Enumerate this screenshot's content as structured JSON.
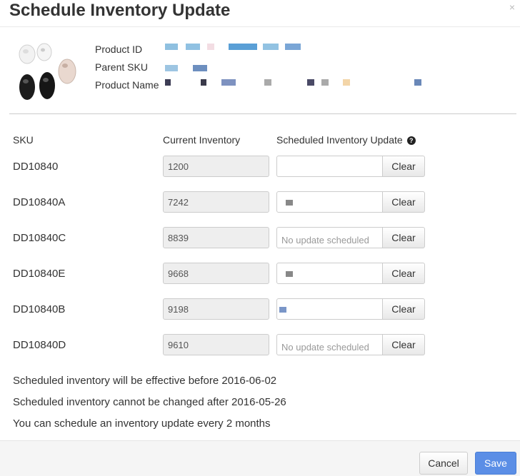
{
  "modal": {
    "title": "Schedule Inventory Update",
    "close_label": "×"
  },
  "product": {
    "id_label": "Product ID",
    "parent_sku_label": "Parent SKU",
    "name_label": "Product Name"
  },
  "table": {
    "headers": {
      "sku": "SKU",
      "current": "Current Inventory",
      "scheduled": "Scheduled Inventory Update"
    },
    "rows": [
      {
        "sku": "DD10840",
        "current": "1200",
        "placeholder": "",
        "clear": "Clear"
      },
      {
        "sku": "DD10840A",
        "current": "7242",
        "placeholder": "",
        "clear": "Clear"
      },
      {
        "sku": "DD10840C",
        "current": "8839",
        "placeholder": "No update scheduled",
        "clear": "Clear"
      },
      {
        "sku": "DD10840E",
        "current": "9668",
        "placeholder": "",
        "clear": "Clear"
      },
      {
        "sku": "DD10840B",
        "current": "9198",
        "placeholder": "",
        "clear": "Clear"
      },
      {
        "sku": "DD10840D",
        "current": "9610",
        "placeholder": "No update scheduled",
        "clear": "Clear"
      }
    ]
  },
  "notes": [
    "Scheduled inventory will be effective before 2016-06-02",
    "Scheduled inventory cannot be changed after 2016-05-26",
    "You can schedule an inventory update every 2 months"
  ],
  "footer": {
    "cancel": "Cancel",
    "save": "Save"
  },
  "colors": {
    "primary": "#5b8ee6",
    "readonly_bg": "#eeeeee"
  }
}
